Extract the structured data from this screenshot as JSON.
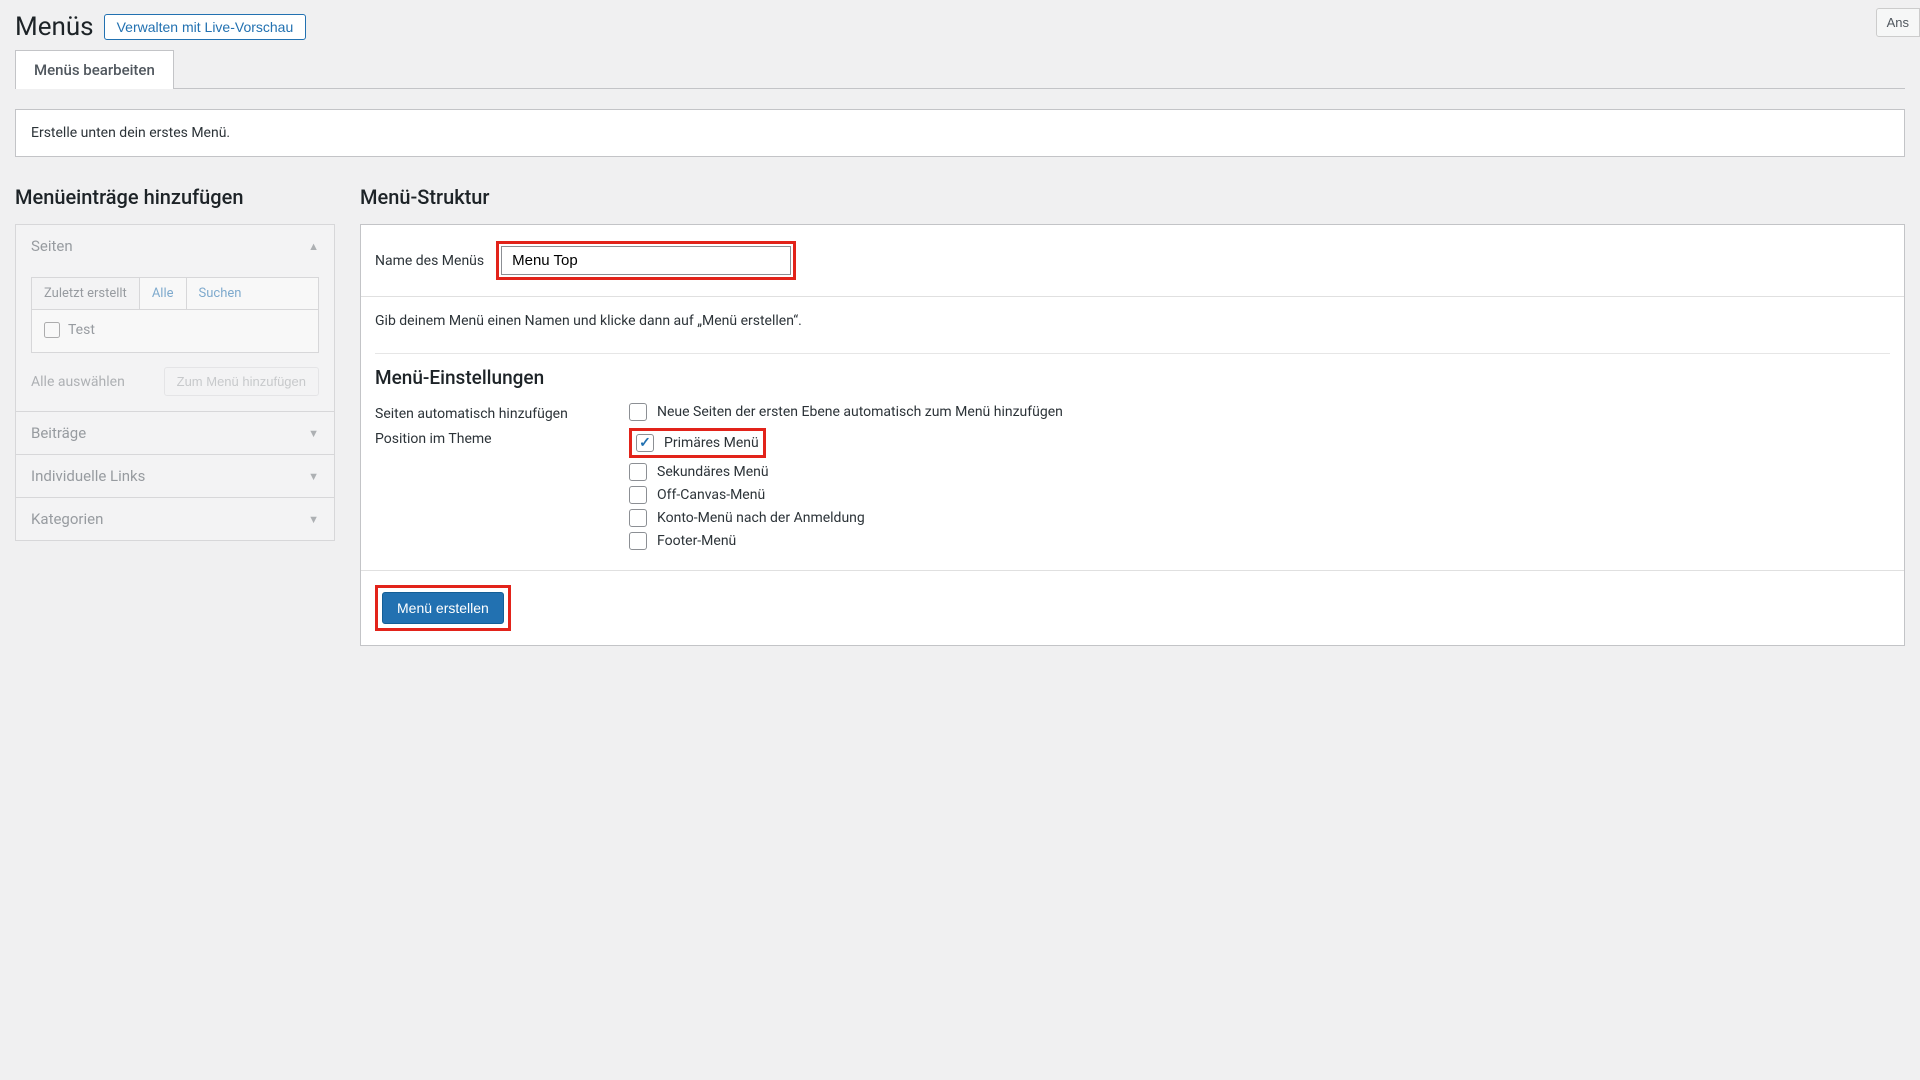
{
  "header": {
    "title": "Menüs",
    "live_preview_label": "Verwalten mit Live-Vorschau",
    "screen_options_label": "Ans"
  },
  "tabs": {
    "edit_menus": "Menüs bearbeiten"
  },
  "notice": {
    "text": "Erstelle unten dein erstes Menü."
  },
  "left": {
    "title": "Menüeinträge hinzufügen",
    "panels": {
      "pages": "Seiten",
      "posts": "Beiträge",
      "links": "Individuelle Links",
      "categories": "Kategorien"
    },
    "mini_tabs": {
      "recent": "Zuletzt erstellt",
      "all": "Alle",
      "search": "Suchen"
    },
    "page_item": "Test",
    "select_all": "Alle auswählen",
    "add_to_menu": "Zum Menü hinzufügen"
  },
  "right": {
    "title": "Menü-Struktur",
    "name_label": "Name des Menüs",
    "name_value": "Menu Top",
    "intro": "Gib deinem Menü einen Namen und klicke dann auf „Menü erstellen“.",
    "settings_title": "Menü-Einstellungen",
    "auto_add_label": "Seiten automatisch hinzufügen",
    "auto_add_option": "Neue Seiten der ersten Ebene automatisch zum Menü hinzufügen",
    "position_label": "Position im Theme",
    "positions": {
      "primary": "Primäres Menü",
      "secondary": "Sekundäres Menü",
      "offcanvas": "Off-Canvas-Menü",
      "account": "Konto-Menü nach der Anmeldung",
      "footer": "Footer-Menü"
    },
    "create_button": "Menü erstellen"
  }
}
